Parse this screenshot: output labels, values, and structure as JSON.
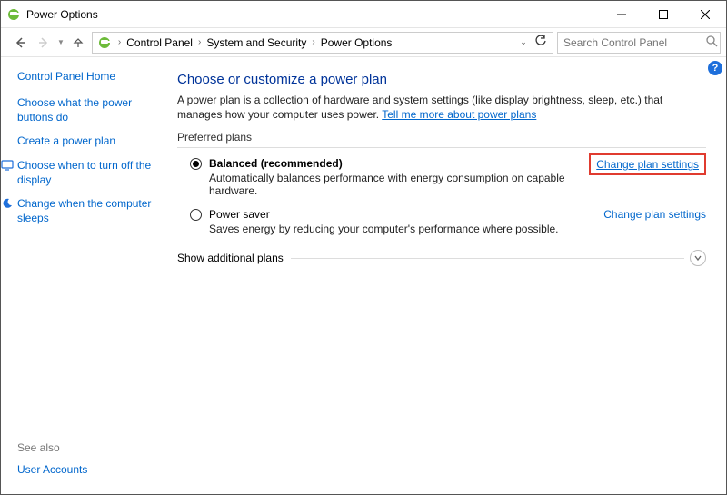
{
  "window": {
    "title": "Power Options"
  },
  "breadcrumb": {
    "b1": "Control Panel",
    "b2": "System and Security",
    "b3": "Power Options"
  },
  "search": {
    "placeholder": "Search Control Panel"
  },
  "sidebar": {
    "home": "Control Panel Home",
    "l1": "Choose what the power buttons do",
    "l2": "Create a power plan",
    "l3": "Choose when to turn off the display",
    "l4": "Change when the computer sleeps"
  },
  "seeAlso": {
    "hd": "See also",
    "l1": "User Accounts"
  },
  "main": {
    "title": "Choose or customize a power plan",
    "descA": "A power plan is a collection of hardware and system settings (like display brightness, sleep, etc.) that manages how your computer uses power. ",
    "descLink": "Tell me more about power plans",
    "preferred": "Preferred plans",
    "plan1": {
      "name": "Balanced (recommended)",
      "sub": "Automatically balances performance with energy consumption on capable hardware.",
      "action": "Change plan settings"
    },
    "plan2": {
      "name": "Power saver",
      "sub": "Saves energy by reducing your computer's performance where possible.",
      "action": "Change plan settings"
    },
    "showMore": "Show additional plans"
  }
}
